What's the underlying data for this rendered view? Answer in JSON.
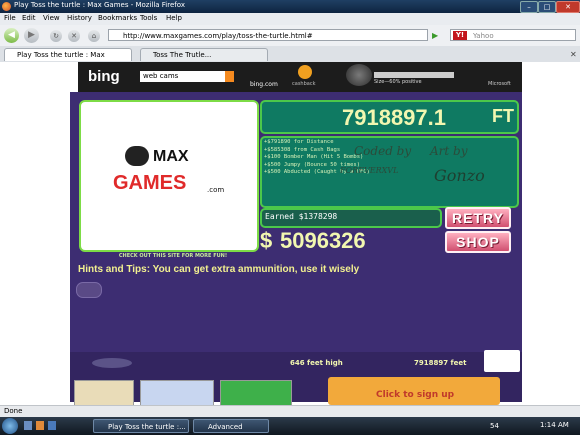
{
  "window": {
    "title": "Play Toss the turtle : Max Games - Mozilla Firefox"
  },
  "menu": [
    "File",
    "Edit",
    "View",
    "History",
    "Bookmarks",
    "Tools",
    "Help"
  ],
  "nav": {
    "url": "http://www.maxgames.com/play/toss-the-turtle.html#",
    "search_placeholder": "Yahoo"
  },
  "tabs": [
    {
      "label": "Play Toss the turtle : Max Games"
    },
    {
      "label": "Toss The Trutle..."
    }
  ],
  "ad": {
    "bing": "bing",
    "search_value": "web cams",
    "bing_com": "bing.com",
    "cashback": "cashback",
    "size": "Size—60% positive",
    "microsoft": "Microsoft"
  },
  "game": {
    "distance": "7918897.1",
    "unit": "FT",
    "details": [
      "+$791890 for Distance",
      "+$585308  from Cash Bags",
      "+$100  Bomber Man (Hit 5 Bombs)",
      "+$500  Jumpy (Bounce 50 times)",
      "+$500  Abducted (Caught by a UFO)"
    ],
    "earned": "Earned $1378298",
    "cash": "5096326",
    "retry": "RETRY",
    "shop": "SHOP",
    "logo_max": "MAX",
    "logo_games": "GAMES",
    "logo_com": ".com",
    "logo_caption": "CHECK OUT THIS SITE FOR MORE FUN!",
    "hint": "Hints and Tips: You can get extra ammunition, use it wisely",
    "height_readout": "646 feet high",
    "distance_readout": "7918897 feet",
    "credit_left": "Coded by",
    "credit_fx": "FOREVERXVL",
    "credit_right": "Art by",
    "credit_gonzo": "Gonzo"
  },
  "page_bottom": {
    "signup": "Click to sign up"
  },
  "status": {
    "text": "Done"
  },
  "taskbar": {
    "items": [
      "Play Toss the turtle :...",
      "Advanced SystemC..."
    ],
    "time": "1:14 AM",
    "tray": "54"
  },
  "colors": {
    "accent": "#4cc84a",
    "panel": "#0f7a62",
    "game_bg": "#3d2d72",
    "button": "#d05070"
  }
}
